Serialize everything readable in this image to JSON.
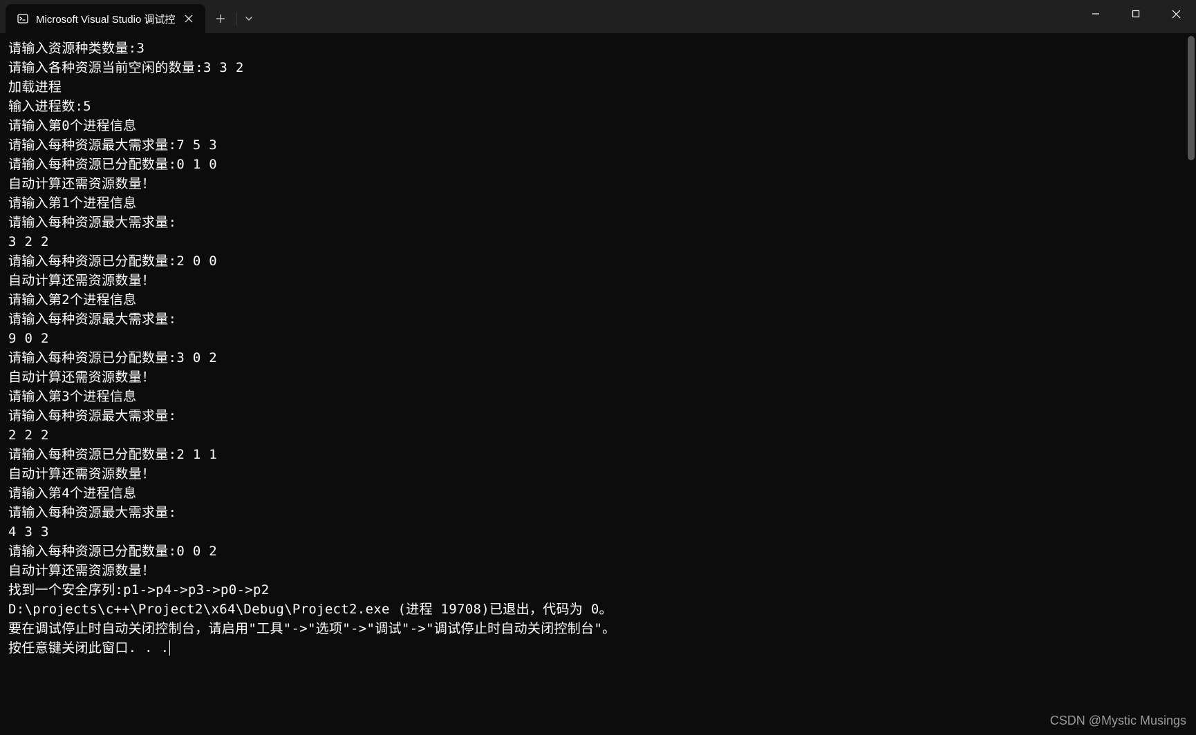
{
  "window": {
    "tab_title": "Microsoft Visual Studio 调试控",
    "watermark": "CSDN @Mystic Musings"
  },
  "console_lines": [
    "请输入资源种类数量:3",
    "请输入各种资源当前空闲的数量:3 3 2",
    "加载进程",
    "输入进程数:5",
    "请输入第0个进程信息",
    "请输入每种资源最大需求量:7 5 3",
    "请输入每种资源已分配数量:0 1 0",
    "自动计算还需资源数量！",
    "请输入第1个进程信息",
    "请输入每种资源最大需求量:",
    "3 2 2",
    "请输入每种资源已分配数量:2 0 0",
    "自动计算还需资源数量！",
    "请输入第2个进程信息",
    "请输入每种资源最大需求量:",
    "9 0 2",
    "请输入每种资源已分配数量:3 0 2",
    "自动计算还需资源数量！",
    "请输入第3个进程信息",
    "请输入每种资源最大需求量:",
    "2 2 2",
    "请输入每种资源已分配数量:2 1 1",
    "自动计算还需资源数量！",
    "请输入第4个进程信息",
    "请输入每种资源最大需求量:",
    "4 3 3",
    "请输入每种资源已分配数量:0 0 2",
    "自动计算还需资源数量！",
    "找到一个安全序列:p1->p4->p3->p0->p2",
    "",
    "D:\\projects\\c++\\Project2\\x64\\Debug\\Project2.exe (进程 19708)已退出，代码为 0。",
    "要在调试停止时自动关闭控制台，请启用\"工具\"->\"选项\"->\"调试\"->\"调试停止时自动关闭控制台\"。",
    "按任意键关闭此窗口. . ."
  ]
}
